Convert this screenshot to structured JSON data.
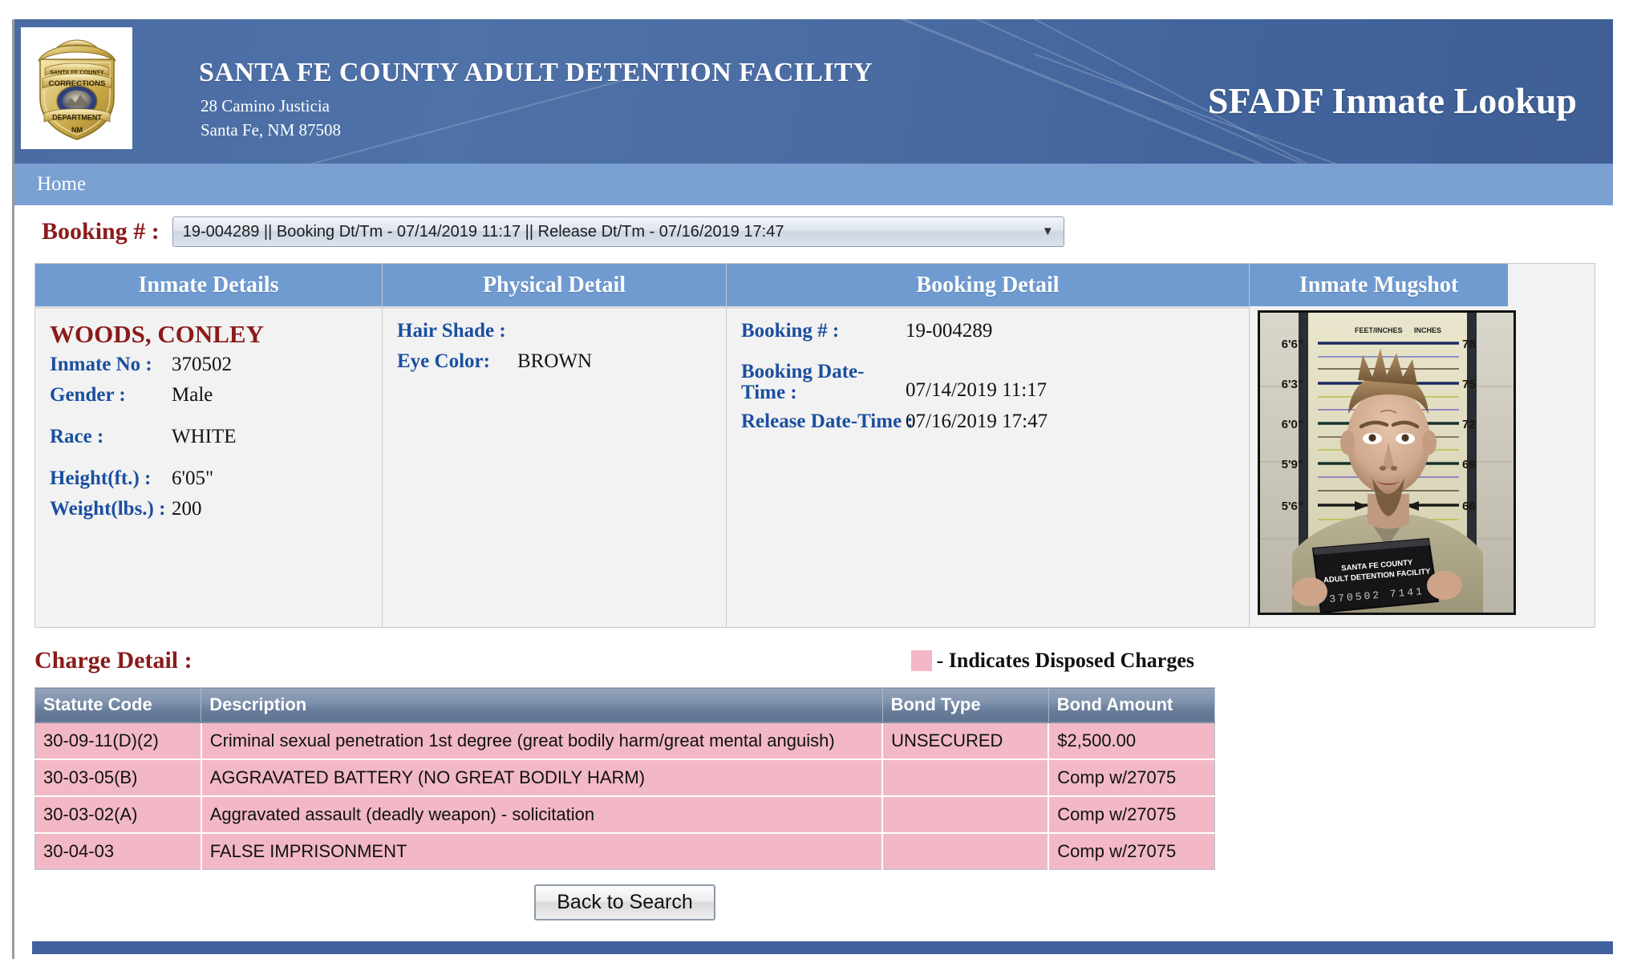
{
  "header": {
    "badge_icon": "sheriff-badge-icon",
    "badge_text": {
      "line1": "SANTA FE COUNTY",
      "line2": "CORRECTIONS",
      "line3": "DEPARTMENT",
      "line4": "NM"
    },
    "agency_name": "SANTA FE COUNTY ADULT DETENTION FACILITY",
    "address_line1": "28 Camino Justicia",
    "address_line2": "Santa Fe, NM 87508",
    "app_title": "SFADF Inmate Lookup",
    "brand_blue": "#4a6ca3"
  },
  "nav": {
    "items": [
      {
        "label": "Home"
      }
    ]
  },
  "booking_selector": {
    "label": "Booking # :",
    "selected": "19-004289 || Booking Dt/Tm - 07/14/2019 11:17 || Release Dt/Tm - 07/16/2019 17:47",
    "options": [
      "19-004289 || Booking Dt/Tm - 07/14/2019 11:17 || Release Dt/Tm - 07/16/2019 17:47"
    ],
    "arrow_icon": "chevron-down-icon"
  },
  "panels": {
    "inmate_details": {
      "title": "Inmate Details",
      "name": "WOODS, CONLEY",
      "fields": [
        {
          "label": "Inmate No :",
          "value": "370502"
        },
        {
          "label": "Gender :",
          "value": "Male"
        },
        {
          "label": "Race :",
          "value": "WHITE"
        },
        {
          "label": "Height(ft.) :",
          "value": "6'05\""
        },
        {
          "label": "Weight(lbs.) :",
          "value": "200"
        }
      ]
    },
    "physical_detail": {
      "title": "Physical Detail",
      "fields": [
        {
          "label": "Hair Shade :",
          "value": ""
        },
        {
          "label": "Eye Color:",
          "value": "BROWN"
        }
      ]
    },
    "booking_detail": {
      "title": "Booking Detail",
      "fields": [
        {
          "label": "Booking # :",
          "value": "19-004289"
        },
        {
          "label": "Booking Date-Time :",
          "value": "07/14/2019 11:17"
        },
        {
          "label": "Release Date-Time :",
          "value": "07/16/2019 17:47"
        }
      ]
    },
    "inmate_mugshot": {
      "title": "Inmate Mugshot",
      "height_chart_feet": [
        "6'6\"",
        "6'3\"",
        "6'0\"",
        "5'9\"",
        "5'6\""
      ],
      "height_chart_inches": [
        "78",
        "75",
        "72",
        "69",
        "66"
      ],
      "chart_header_left": "FEET/INCHES",
      "chart_header_right": "INCHES",
      "placard_line1": "SANTA FE COUNTY",
      "placard_line2": "ADULT DETENTION FACILITY",
      "placard_number": "370502  7141"
    }
  },
  "charge_detail": {
    "title": "Charge Detail :",
    "legend_text": "- Indicates Disposed Charges",
    "legend_color": "#f2b8c6",
    "columns": [
      "Statute Code",
      "Description",
      "Bond Type",
      "Bond Amount"
    ],
    "rows": [
      {
        "statute_code": "30-09-11(D)(2)",
        "description": "Criminal sexual penetration 1st degree (great bodily harm/great mental anguish)",
        "bond_type": "UNSECURED",
        "bond_amount": "$2,500.00",
        "disposed": true
      },
      {
        "statute_code": "30-03-05(B)",
        "description": "AGGRAVATED BATTERY (NO GREAT BODILY HARM)",
        "bond_type": "",
        "bond_amount": "Comp w/27075",
        "disposed": true
      },
      {
        "statute_code": "30-03-02(A)",
        "description": "Aggravated assault (deadly weapon) - solicitation",
        "bond_type": "",
        "bond_amount": "Comp w/27075",
        "disposed": true
      },
      {
        "statute_code": "30-04-03",
        "description": "FALSE IMPRISONMENT",
        "bond_type": "",
        "bond_amount": "Comp w/27075",
        "disposed": true
      }
    ]
  },
  "actions": {
    "back_label": "Back to Search"
  }
}
